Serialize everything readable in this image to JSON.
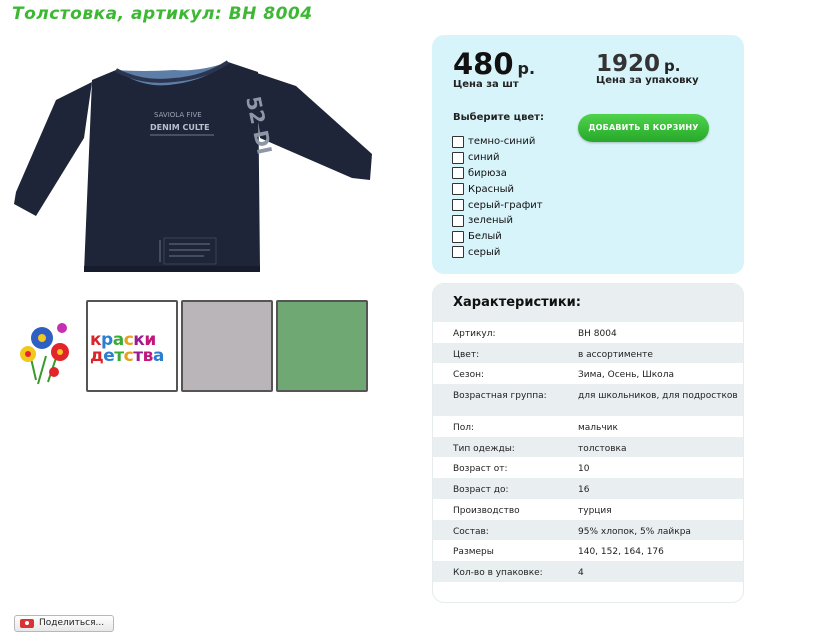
{
  "page_title": "Толстовка, артикул: BH 8004",
  "product_image": {
    "shirt_color": "#1e2538",
    "print_text_1": "SAVIOLA FIVE",
    "print_text_2": "DENIM CULTE",
    "sleeve_text": "52 DI"
  },
  "thumbnails": {
    "brand_line_1": "краски",
    "brand_line_2": "детства",
    "swatches": [
      "#b9b5b8",
      "#70a873"
    ]
  },
  "price": {
    "unit_value": "480",
    "unit_currency": "р.",
    "unit_label": "Цена за шт",
    "pack_value": "1920",
    "pack_currency": "р.",
    "pack_label": "Цена за упаковку"
  },
  "color_select": {
    "title": "Выберите цвет:",
    "options": [
      "темно-синий",
      "синий",
      "бирюза",
      "Красный",
      "серый-графит",
      "зеленый",
      "Белый",
      "серый"
    ]
  },
  "cart_button": "ДОБАВИТЬ В КОРЗИНУ",
  "specs": {
    "title": "Характеристики:",
    "rows": [
      {
        "key": "Артикул:",
        "value": "BH 8004"
      },
      {
        "key": "Цвет:",
        "value": "в ассортименте"
      },
      {
        "key": "Сезон:",
        "value": "Зима, Осень, Школа"
      },
      {
        "key": "Возрастная группа:",
        "value": "для школьников, для подростков"
      },
      {
        "key": "Пол:",
        "value": "мальчик"
      },
      {
        "key": "Тип одежды:",
        "value": "толстовка"
      },
      {
        "key": "Возраст от:",
        "value": "10"
      },
      {
        "key": "Возраст до:",
        "value": "16"
      },
      {
        "key": "Производство",
        "value": "турция"
      },
      {
        "key": "Состав:",
        "value": "95% хлопок, 5% лайкра"
      },
      {
        "key": "Размеры",
        "value": "140, 152, 164, 176"
      },
      {
        "key": "Кол-во в упаковке:",
        "value": "4"
      }
    ]
  },
  "share_label": "Поделиться..."
}
